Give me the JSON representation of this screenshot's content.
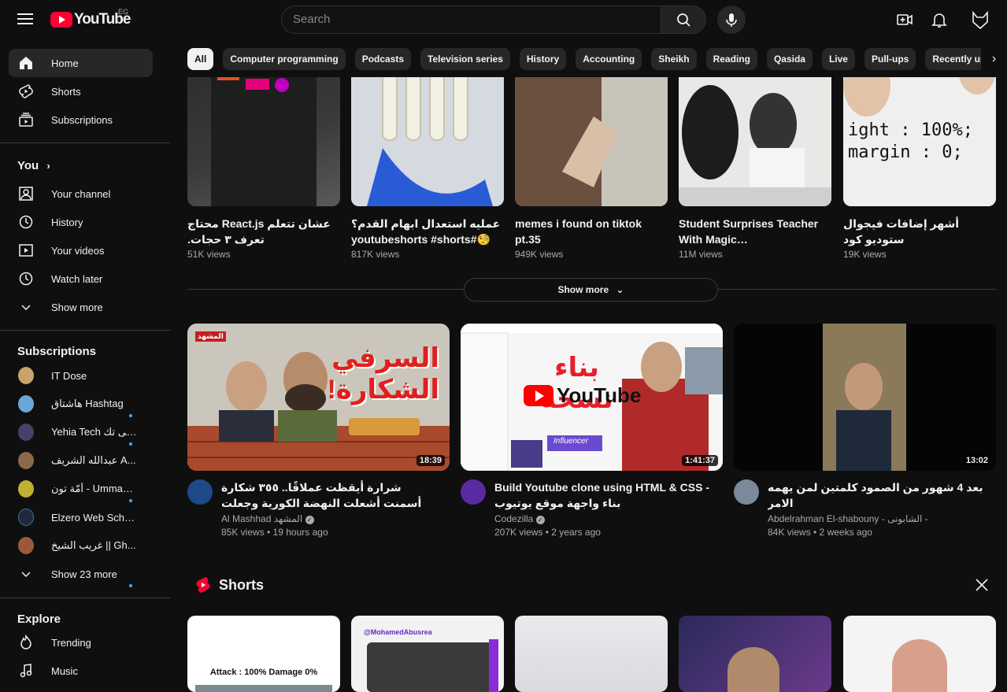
{
  "header": {
    "logo_text": "YouTube",
    "country_code": "EG",
    "search_placeholder": "Search"
  },
  "sidebar": {
    "main": [
      {
        "label": "Home",
        "icon": "home-icon"
      },
      {
        "label": "Shorts",
        "icon": "shorts-icon"
      },
      {
        "label": "Subscriptions",
        "icon": "subscriptions-icon"
      }
    ],
    "you_heading": "You",
    "you_items": [
      {
        "label": "Your channel",
        "icon": "your-channel-icon"
      },
      {
        "label": "History",
        "icon": "history-icon"
      },
      {
        "label": "Your videos",
        "icon": "your-videos-icon"
      },
      {
        "label": "Watch later",
        "icon": "watch-later-icon"
      },
      {
        "label": "Show more",
        "icon": "chevron-down-icon"
      }
    ],
    "subscriptions_heading": "Subscriptions",
    "subscriptions": [
      {
        "label": "IT Dose",
        "color": "#c9a36a"
      },
      {
        "label": "هاشتاق Hashtag",
        "color": "#6aa6d6"
      },
      {
        "label": "Yehia Tech يحيى تك",
        "color": "#4a3f6b"
      },
      {
        "label": "عبدالله الشريف A...",
        "color": "#8a6a4a"
      },
      {
        "label": "أمّة تون - Ummah T...",
        "color": "#c2b030"
      },
      {
        "label": "Elzero Web School",
        "color": "#1e2a3a"
      },
      {
        "label": "غريب الشيخ || Gh...",
        "color": "#9a5a3a"
      }
    ],
    "show_more_subs": "Show 23 more",
    "explore_heading": "Explore",
    "explore": [
      {
        "label": "Trending",
        "icon": "trending-icon"
      },
      {
        "label": "Music",
        "icon": "music-icon"
      }
    ]
  },
  "chips": [
    "All",
    "Computer programming",
    "Podcasts",
    "Television series",
    "History",
    "Accounting",
    "Sheikh",
    "Reading",
    "Qasida",
    "Live",
    "Pull-ups",
    "Recently uploaded"
  ],
  "top_shorts": [
    {
      "title": "عشان تتعلم React.js محتاج تعرف ٣ حجات.",
      "views": "51K views"
    },
    {
      "title": "عمليه استعدال ابهام القدم؟ 🧐#youtubeshorts #shorts",
      "views": "817K views"
    },
    {
      "title": "memes i found on tiktok pt.35",
      "views": "949K views"
    },
    {
      "title": "Student Surprises Teacher With Magic…",
      "views": "11M views"
    },
    {
      "title": "أشهر إضافات فيجوال ستوديو كود",
      "views": "19K views"
    }
  ],
  "top_short_text": {
    "thumb5": [
      "ight : 100%;",
      "margin : 0;"
    ]
  },
  "show_more": "Show more",
  "videos": [
    {
      "title": "شرارة أيقظت عملاقًا.. ٣٥٥ شكارة أسمنت أشعلت النهضة الكورية وجعلت شركاتها لا...",
      "channel": "Al Mashhad المشهد",
      "meta": "85K views • 19 hours ago",
      "duration": "18:39",
      "verified": true,
      "thumb_text": "السرفي الشكارة!",
      "brand": "المشهد"
    },
    {
      "title": "Build Youtube clone using HTML & CSS - بناء واجهة موقع يوتيوب",
      "channel": "Codezilla",
      "meta": "207K views • 2 years ago",
      "duration": "1:41:37",
      "verified": true,
      "thumb_text": "بناء نسخة",
      "brand": "YouTube",
      "badge": "Influencer"
    },
    {
      "title": "بعد 4 شهور من الصمود كلمتين لمن يهمه الامر",
      "channel": "Abdelrahman El-shabouny - الشابونى -",
      "meta": "84K views • 2 weeks ago",
      "duration": "13:02",
      "verified": false
    }
  ],
  "shorts_section_title": "Shorts",
  "bottom_short_text": {
    "thumb1": "Attack : 100%   Damage 0%",
    "thumb2": "@MohamedAbusrea"
  }
}
